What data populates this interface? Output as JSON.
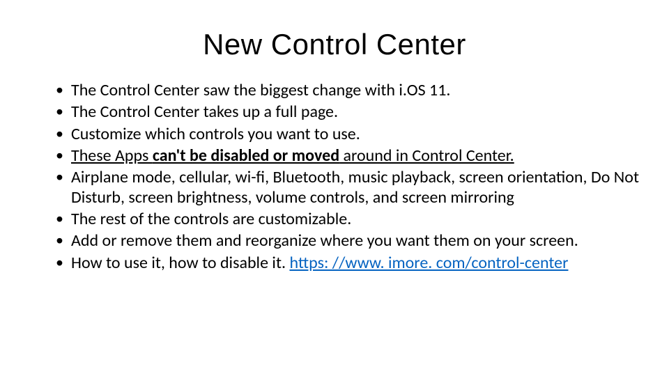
{
  "title": "New Control Center",
  "bullets": {
    "b1": "The Control Center saw the biggest change with i.OS 11.",
    "b2": "The Control Center takes up a full page.",
    "b3": "Customize which controls you want to use.",
    "b4_pre": "These Apps ",
    "b4_bold": "can't be disabled or moved",
    "b4_post": " around in Control Center.",
    "b5": "Airplane mode, cellular, wi-fi, Bluetooth, music playback, screen orientation, Do Not Disturb, screen brightness, volume controls, and screen mirroring",
    "b6": "The rest of the controls are customizable.",
    "b7": "Add or remove them and reorganize where you want them on your screen.",
    "b8_pre": "How to use it, how to disable it. ",
    "b8_link": "https: //www. imore. com/control-center"
  }
}
